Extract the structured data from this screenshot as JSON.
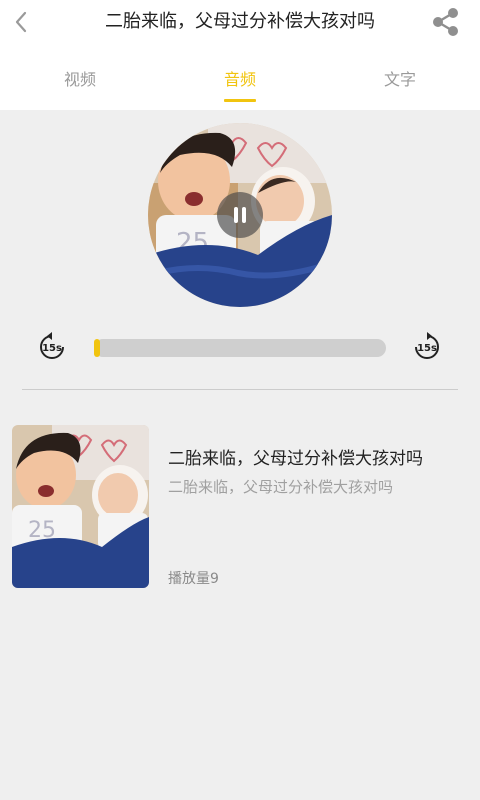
{
  "header": {
    "title": "二胎来临，父母过分补偿大孩对吗",
    "back_icon": "chevron-left-icon",
    "share_icon": "share-icon"
  },
  "tabs": [
    {
      "label": "视频",
      "active": false
    },
    {
      "label": "音频",
      "active": true
    },
    {
      "label": "文字",
      "active": false
    }
  ],
  "player": {
    "rewind_label": "15s",
    "forward_label": "15s",
    "progress": 0.01,
    "state": "playing"
  },
  "card": {
    "title": "二胎来临，父母过分补偿大孩对吗",
    "subtitle": "二胎来临，父母过分补偿大孩对吗",
    "plays": "播放量9"
  },
  "colors": {
    "accent": "#f1c40f",
    "background": "#efefef"
  }
}
